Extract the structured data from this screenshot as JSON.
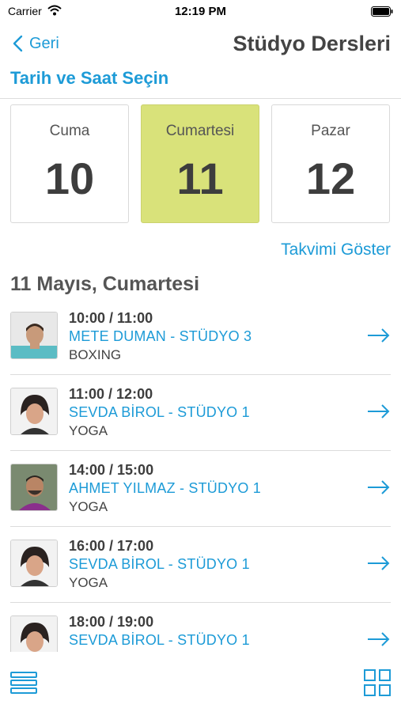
{
  "status": {
    "carrier": "Carrier",
    "time": "12:19 PM"
  },
  "nav": {
    "back_label": "Geri",
    "title": "Stüdyo Dersleri"
  },
  "section_title": "Tarih ve Saat Seçin",
  "days": [
    {
      "name": "Cuma",
      "num": "10"
    },
    {
      "name": "Cumartesi",
      "num": "11"
    },
    {
      "name": "Pazar",
      "num": "12"
    }
  ],
  "selected_day_index": 1,
  "calendar_link": "Takvimi Göster",
  "date_heading": "11 Mayıs, Cumartesi",
  "classes": [
    {
      "time": "10:00 / 11:00",
      "title": "METE DUMAN - STÜDYO 3",
      "type": "BOXING"
    },
    {
      "time": "11:00 / 12:00",
      "title": "SEVDA BİROL - STÜDYO 1",
      "type": "YOGA"
    },
    {
      "time": "14:00 / 15:00",
      "title": "AHMET YILMAZ - STÜDYO 1",
      "type": "YOGA"
    },
    {
      "time": "16:00 / 17:00",
      "title": "SEVDA BİROL - STÜDYO 1",
      "type": "YOGA"
    },
    {
      "time": "18:00 / 19:00",
      "title": "SEVDA BİROL - STÜDYO 1",
      "type": ""
    }
  ],
  "colors": {
    "accent": "#1d9bd7",
    "selected_day": "#d9e27a"
  },
  "icons": {
    "back": "chevron-left-icon",
    "row_action": "arrow-right-icon",
    "list_view": "list-icon",
    "grid_view": "grid-icon"
  }
}
